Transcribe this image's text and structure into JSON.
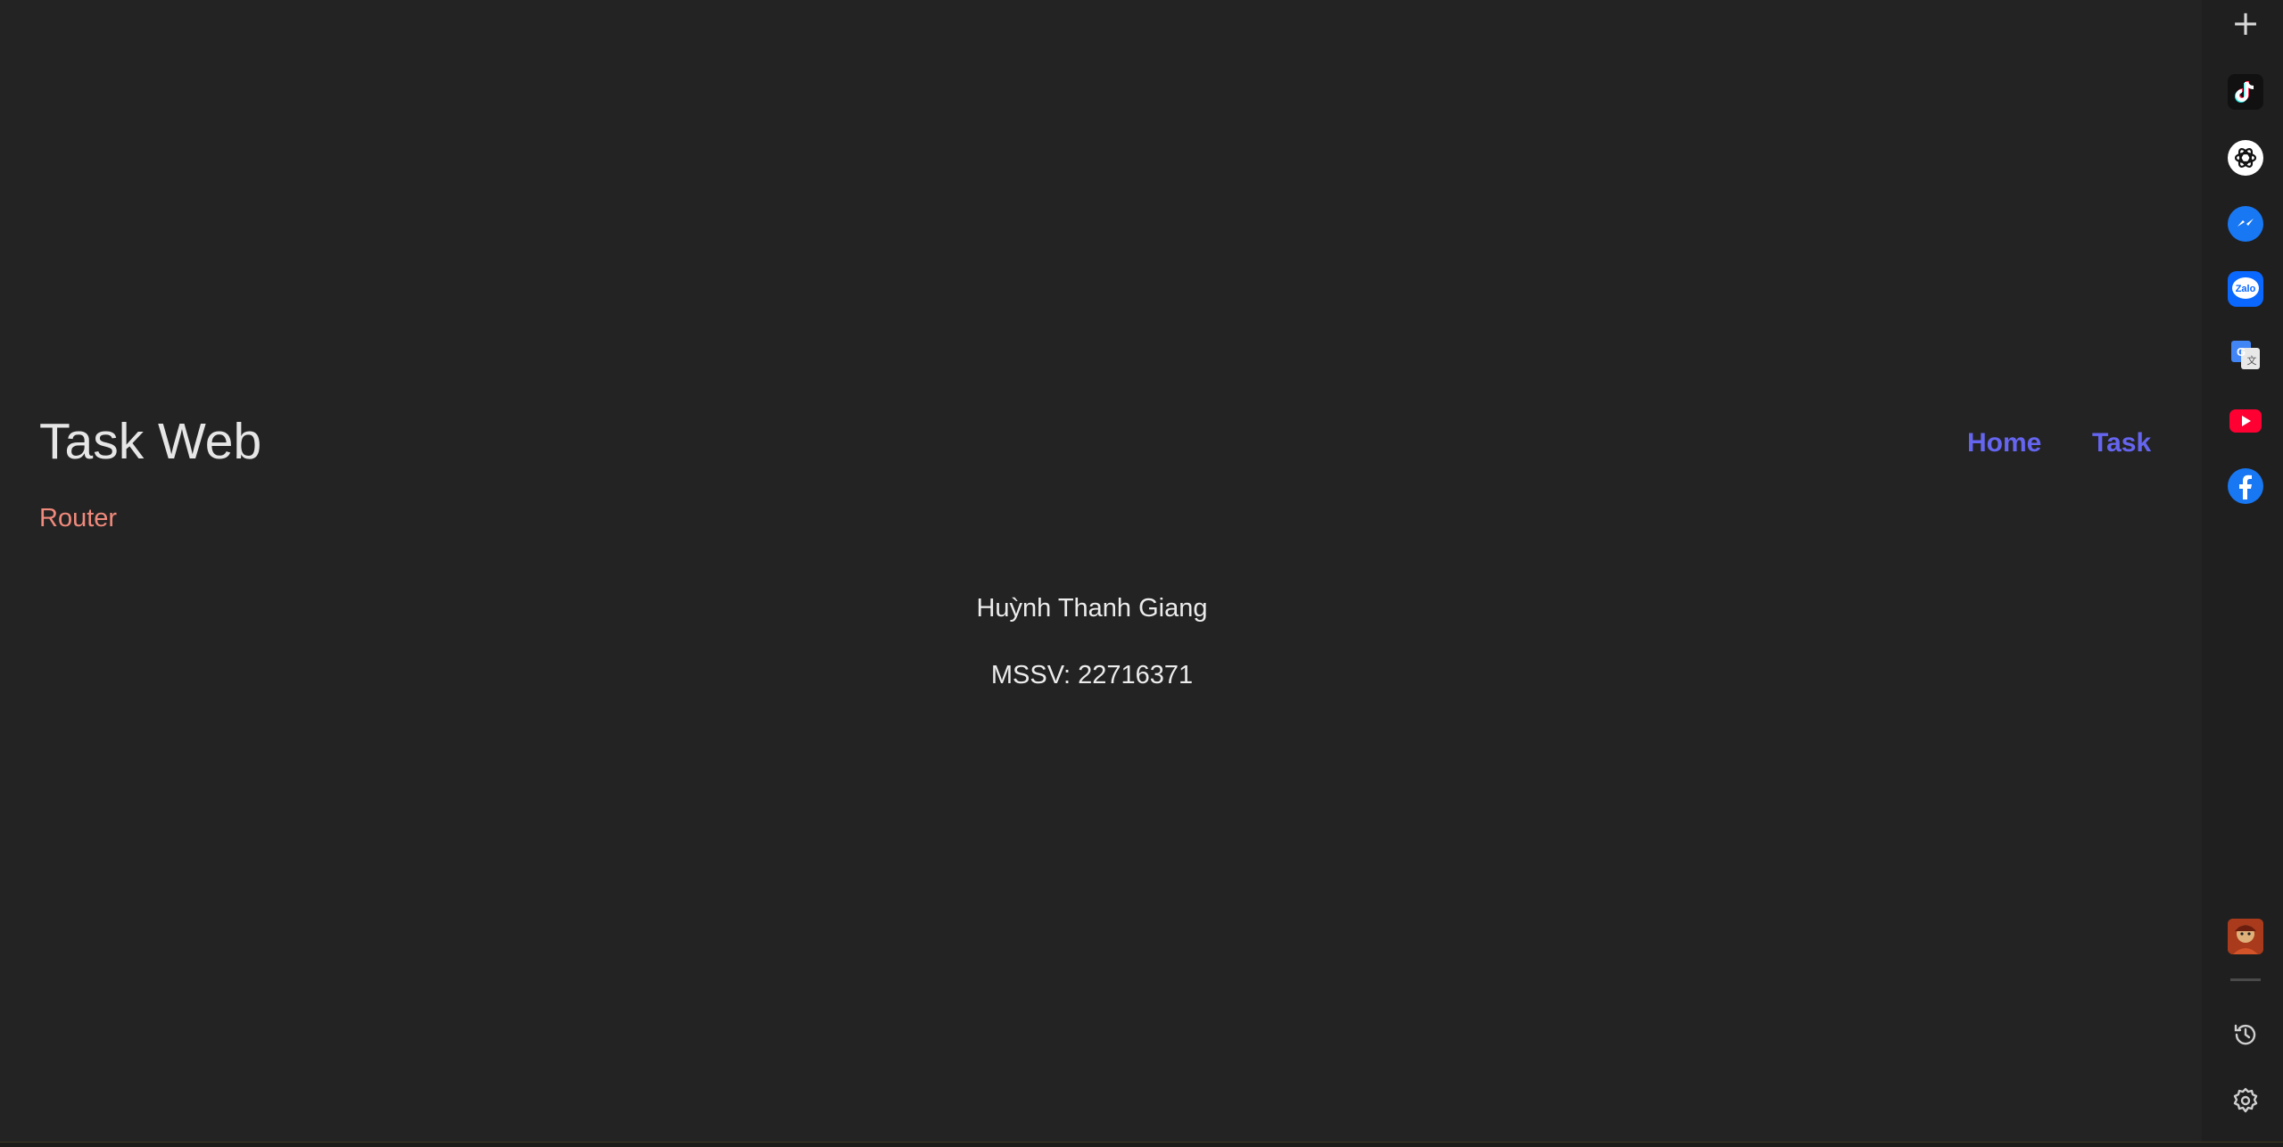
{
  "header": {
    "title": "Task Web",
    "subtitle": "Router"
  },
  "nav": {
    "items": [
      {
        "label": "Home"
      },
      {
        "label": "Task"
      }
    ]
  },
  "content": {
    "name": "Huỳnh Thanh Giang",
    "student_id": "MSSV: 22716371"
  },
  "sidebar": {
    "items": [
      {
        "icon": "plus-icon"
      },
      {
        "icon": "tiktok-icon"
      },
      {
        "icon": "chatgpt-icon"
      },
      {
        "icon": "messenger-icon"
      },
      {
        "icon": "zalo-icon",
        "text": "Zalo"
      },
      {
        "icon": "google-translate-icon"
      },
      {
        "icon": "youtube-icon"
      },
      {
        "icon": "facebook-icon"
      },
      {
        "icon": "avatar-icon"
      },
      {
        "icon": "history-icon"
      },
      {
        "icon": "settings-icon"
      }
    ]
  },
  "colors": {
    "background": "#232323",
    "title": "#e6e6e6",
    "subtitle": "#f08a7c",
    "nav_link": "#6565f0",
    "text": "#ececec"
  }
}
